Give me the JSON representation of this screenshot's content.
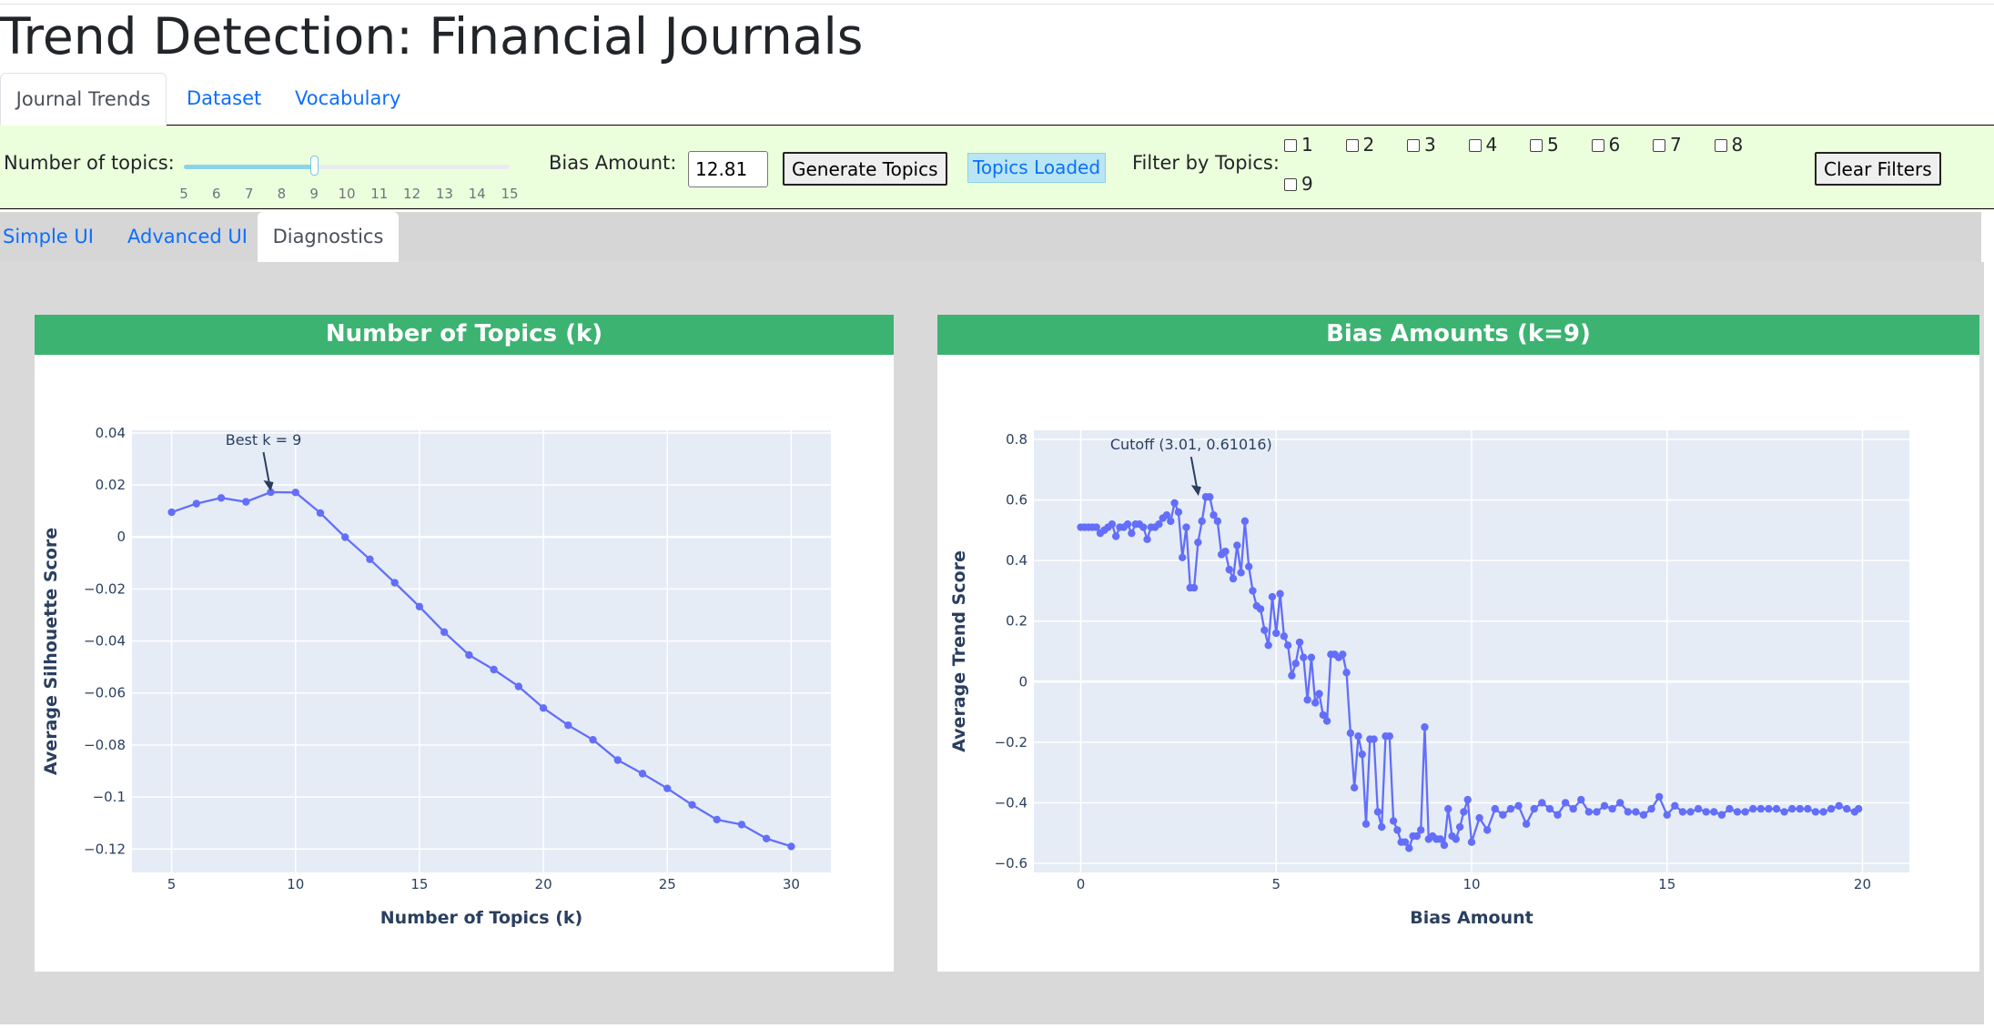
{
  "page_title": "Trend Detection: Financial Journals",
  "main_tabs": [
    {
      "label": "Journal Trends",
      "active": true
    },
    {
      "label": "Dataset",
      "active": false
    },
    {
      "label": "Vocabulary",
      "active": false
    }
  ],
  "toolbar": {
    "topics_label": "Number of topics:",
    "slider": {
      "min": 5,
      "max": 15,
      "value": 9,
      "ticks": [
        "5",
        "6",
        "7",
        "8",
        "9",
        "10",
        "11",
        "12",
        "13",
        "14",
        "15"
      ]
    },
    "bias_label": "Bias Amount:",
    "bias_value": "12.81",
    "generate_label": "Generate Topics",
    "status_text": "Topics Loaded",
    "filter_label": "Filter by Topics:",
    "filter_options": [
      "1",
      "2",
      "3",
      "4",
      "5",
      "6",
      "7",
      "8",
      "9"
    ],
    "clear_label": "Clear Filters"
  },
  "sub_tabs": [
    {
      "label": "Simple UI",
      "active": false
    },
    {
      "label": "Advanced UI",
      "active": false
    },
    {
      "label": "Diagnostics",
      "active": true
    }
  ],
  "colors": {
    "accent": "#0d6efd",
    "panel_header": "#3cb371",
    "toolbar_bg": "#ecffdc",
    "plot_bg": "#e5ecf6",
    "series": "#636efa",
    "status_bg": "#b9e6f2"
  },
  "chart_data": [
    {
      "type": "line",
      "title": "Number of Topics (k)",
      "xlabel": "Number of Topics (k)",
      "ylabel": "Average Silhouette Score",
      "xlim": [
        3.4,
        31.6
      ],
      "ylim": [
        -0.129,
        0.041
      ],
      "x_ticks": [
        5,
        10,
        15,
        20,
        25,
        30
      ],
      "x_tick_labels": [
        "5",
        "10",
        "15",
        "20",
        "25",
        "30"
      ],
      "y_ticks": [
        0.04,
        0.02,
        0,
        -0.02,
        -0.04,
        -0.06,
        -0.08,
        -0.1,
        -0.12
      ],
      "y_tick_labels": [
        "0.04",
        "0.02",
        "0",
        "−0.02",
        "−0.04",
        "−0.06",
        "−0.08",
        "−0.1",
        "−0.12"
      ],
      "grid": true,
      "x": [
        5,
        6,
        7,
        8,
        9,
        10,
        11,
        12,
        13,
        14,
        15,
        16,
        17,
        18,
        19,
        20,
        21,
        22,
        23,
        24,
        25,
        26,
        27,
        28,
        29,
        30
      ],
      "y": [
        0.0095,
        0.0128,
        0.015,
        0.0135,
        0.0172,
        0.0171,
        0.0092,
        -0.0001,
        -0.0086,
        -0.0176,
        -0.0268,
        -0.0366,
        -0.0454,
        -0.051,
        -0.0575,
        -0.0658,
        -0.0724,
        -0.078,
        -0.0858,
        -0.091,
        -0.0967,
        -0.103,
        -0.1087,
        -0.1106,
        -0.116,
        -0.119
      ],
      "annotation": {
        "text": "Best k = 9",
        "x": 9,
        "y": 0.0172
      }
    },
    {
      "type": "line",
      "title": "Bias Amounts (k=9)",
      "xlabel": "Bias Amount",
      "ylabel": "Average Trend Score",
      "xlim": [
        -1.2,
        21.2
      ],
      "ylim": [
        -0.63,
        0.83
      ],
      "x_ticks": [
        0,
        5,
        10,
        15,
        20
      ],
      "x_tick_labels": [
        "0",
        "5",
        "10",
        "15",
        "20"
      ],
      "y_ticks": [
        0.8,
        0.6,
        0.4,
        0.2,
        0,
        -0.2,
        -0.4,
        -0.6
      ],
      "y_tick_labels": [
        "0.8",
        "0.6",
        "0.4",
        "0.2",
        "0",
        "−0.2",
        "−0.4",
        "−0.6"
      ],
      "grid": true,
      "x": [
        0,
        0.1,
        0.2,
        0.3,
        0.4,
        0.5,
        0.6,
        0.7,
        0.8,
        0.9,
        1.0,
        1.1,
        1.2,
        1.3,
        1.4,
        1.5,
        1.6,
        1.7,
        1.8,
        1.9,
        2.0,
        2.1,
        2.2,
        2.3,
        2.4,
        2.5,
        2.6,
        2.7,
        2.8,
        2.9,
        3.0,
        3.1,
        3.2,
        3.3,
        3.4,
        3.5,
        3.6,
        3.7,
        3.8,
        3.9,
        4.0,
        4.1,
        4.2,
        4.3,
        4.4,
        4.5,
        4.6,
        4.7,
        4.8,
        4.9,
        5.0,
        5.1,
        5.2,
        5.3,
        5.4,
        5.5,
        5.6,
        5.7,
        5.8,
        5.9,
        6.0,
        6.1,
        6.2,
        6.3,
        6.4,
        6.5,
        6.6,
        6.7,
        6.8,
        6.9,
        7.0,
        7.1,
        7.2,
        7.3,
        7.4,
        7.5,
        7.6,
        7.7,
        7.8,
        7.9,
        8.0,
        8.1,
        8.2,
        8.3,
        8.4,
        8.5,
        8.6,
        8.7,
        8.8,
        8.9,
        9.0,
        9.1,
        9.2,
        9.3,
        9.4,
        9.5,
        9.6,
        9.7,
        9.8,
        9.9,
        10.0,
        10.2,
        10.4,
        10.6,
        10.8,
        11.0,
        11.2,
        11.4,
        11.6,
        11.8,
        12.0,
        12.2,
        12.4,
        12.6,
        12.8,
        13.0,
        13.2,
        13.4,
        13.6,
        13.8,
        14.0,
        14.2,
        14.4,
        14.6,
        14.8,
        15.0,
        15.2,
        15.4,
        15.6,
        15.8,
        16.0,
        16.2,
        16.4,
        16.6,
        16.8,
        17.0,
        17.2,
        17.4,
        17.6,
        17.8,
        18.0,
        18.2,
        18.4,
        18.6,
        18.8,
        19.0,
        19.2,
        19.4,
        19.6,
        19.8,
        19.9
      ],
      "y": [
        0.51,
        0.51,
        0.51,
        0.51,
        0.51,
        0.49,
        0.5,
        0.51,
        0.52,
        0.48,
        0.51,
        0.51,
        0.52,
        0.49,
        0.52,
        0.52,
        0.51,
        0.47,
        0.51,
        0.51,
        0.52,
        0.54,
        0.55,
        0.53,
        0.59,
        0.56,
        0.41,
        0.51,
        0.31,
        0.31,
        0.46,
        0.53,
        0.61,
        0.61,
        0.55,
        0.53,
        0.42,
        0.43,
        0.37,
        0.34,
        0.45,
        0.36,
        0.53,
        0.38,
        0.3,
        0.25,
        0.24,
        0.17,
        0.12,
        0.28,
        0.16,
        0.29,
        0.15,
        0.12,
        0.02,
        0.06,
        0.13,
        0.08,
        -0.06,
        0.08,
        -0.07,
        -0.04,
        -0.11,
        -0.13,
        0.09,
        0.09,
        0.08,
        0.09,
        0.03,
        -0.17,
        -0.35,
        -0.18,
        -0.24,
        -0.47,
        -0.19,
        -0.19,
        -0.43,
        -0.48,
        -0.18,
        -0.18,
        -0.46,
        -0.49,
        -0.53,
        -0.53,
        -0.55,
        -0.51,
        -0.51,
        -0.49,
        -0.15,
        -0.52,
        -0.51,
        -0.52,
        -0.52,
        -0.54,
        -0.42,
        -0.51,
        -0.52,
        -0.48,
        -0.43,
        -0.39,
        -0.53,
        -0.45,
        -0.49,
        -0.42,
        -0.44,
        -0.42,
        -0.41,
        -0.47,
        -0.42,
        -0.4,
        -0.42,
        -0.44,
        -0.4,
        -0.42,
        -0.39,
        -0.43,
        -0.43,
        -0.41,
        -0.42,
        -0.4,
        -0.43,
        -0.43,
        -0.44,
        -0.42,
        -0.38,
        -0.44,
        -0.41,
        -0.43,
        -0.43,
        -0.42,
        -0.43,
        -0.43,
        -0.44,
        -0.42,
        -0.43,
        -0.43,
        -0.42,
        -0.42,
        -0.42,
        -0.42,
        -0.43,
        -0.42,
        -0.42,
        -0.42,
        -0.43,
        -0.43,
        -0.42,
        -0.41,
        -0.42,
        -0.43,
        -0.42,
        -0.42,
        -0.41,
        -0.41,
        -0.42,
        -0.42,
        -0.41,
        -0.43,
        -0.41,
        -0.42,
        -0.41,
        -0.43,
        -0.41,
        -0.42,
        -0.42,
        -0.41,
        -0.43,
        -0.4,
        -0.42,
        -0.4,
        -0.39,
        -0.4
      ],
      "annotation": {
        "text": "Cutoff (3.01, 0.61016)",
        "x": 3.01,
        "y": 0.61016
      }
    }
  ]
}
